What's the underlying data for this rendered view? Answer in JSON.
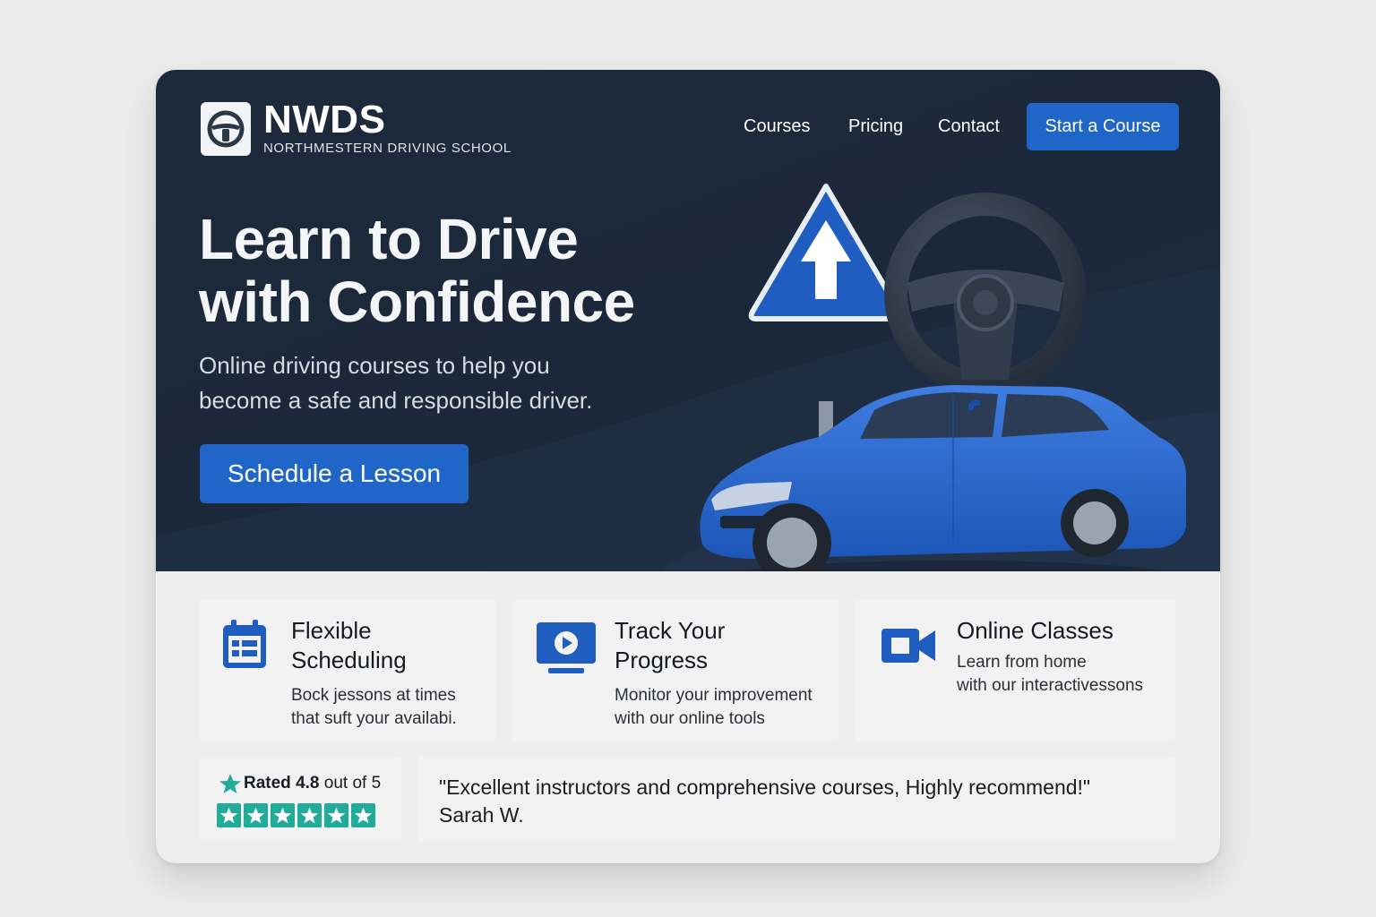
{
  "brand": {
    "name": "NWDS",
    "subtitle": "NORTHMESTERN DRIVING SCHOOL",
    "logo_icon": "steering-wheel-icon"
  },
  "nav": {
    "links": [
      "Courses",
      "Pricing",
      "Contact"
    ],
    "cta_label": "Start a Course"
  },
  "hero": {
    "title_line1": "Learn to Drive",
    "title_line2": "with Confidence",
    "subtitle_line1": "Online driving courses to help you",
    "subtitle_line2": "become a safe and responsible driver.",
    "cta_label": "Schedule a Lesson",
    "illustration": "road-sign-steering-wheel-car"
  },
  "features": [
    {
      "icon": "calendar-icon",
      "title_line1": "Flexible",
      "title_line2": "Scheduling",
      "desc_line1": "Bock jessons at times",
      "desc_line2": "that suft your availabi."
    },
    {
      "icon": "monitor-play-icon",
      "title_line1": "Track Your",
      "title_line2": "Progress",
      "desc_line1": "Monitor your improvement",
      "desc_line2": "with our online tools"
    },
    {
      "icon": "video-camera-icon",
      "title_line1": "Online Classes",
      "desc_line1": "Learn from home",
      "desc_line2": "with our interactivessons"
    }
  ],
  "rating": {
    "prefix": "Rated",
    "score": "4.8",
    "suffix": "out of 5",
    "stars": 6
  },
  "testimonial": {
    "quote": "\"Excellent instructors and comprehensive courses, Highly recommend!\"",
    "author": "Sarah W."
  },
  "colors": {
    "hero_bg": "#1b283a",
    "accent": "#1f66c8",
    "star": "#22ab98",
    "card_bg": "#f2f2f3"
  }
}
